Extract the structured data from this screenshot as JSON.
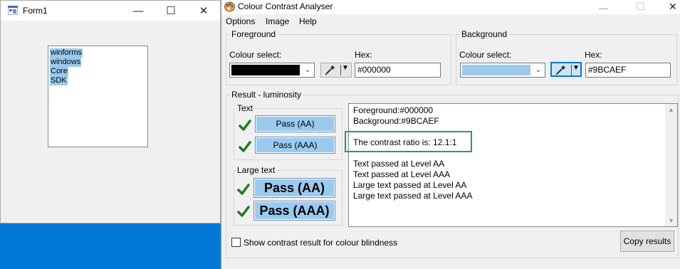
{
  "form1": {
    "title": "Form1",
    "listbox_items": [
      "winforms",
      "windows",
      "Core",
      "SDK"
    ]
  },
  "cca": {
    "title": "Colour Contrast Analyser",
    "menu": [
      "Options",
      "Image",
      "Help"
    ],
    "foreground": {
      "group_label": "Foreground",
      "colour_select_label": "Colour select:",
      "swatch_color": "#000000",
      "hex_label": "Hex:",
      "hex_value": "#000000"
    },
    "background": {
      "group_label": "Background",
      "colour_select_label": "Colour select:",
      "swatch_color": "#9BCAEF",
      "hex_label": "Hex:",
      "hex_value": "#9BCAEF"
    },
    "result": {
      "group_label": "Result - luminosity",
      "text_group_label": "Text",
      "large_text_group_label": "Large text",
      "text_aa": "Pass (AA)",
      "text_aaa": "Pass (AAA)",
      "large_aa": "Pass (AA)",
      "large_aaa": "Pass (AAA)",
      "lines": {
        "fg": "Foreground:#000000",
        "bg": "Background:#9BCAEF",
        "ratio": "The contrast ratio is: 12.1:1",
        "l1": "Text passed at Level AA",
        "l2": "Text passed at Level AAA",
        "l3": "Large text passed at Level AA",
        "l4": "Large text passed at Level AAA"
      }
    },
    "colour_blindness_label": "Show contrast result for colour blindness",
    "copy_results_label": "Copy results"
  },
  "colors": {
    "desktop": "#0078d7",
    "pass": "#9BCAEF",
    "check": "#1e7d1e",
    "highlight": "#2e9f46"
  }
}
